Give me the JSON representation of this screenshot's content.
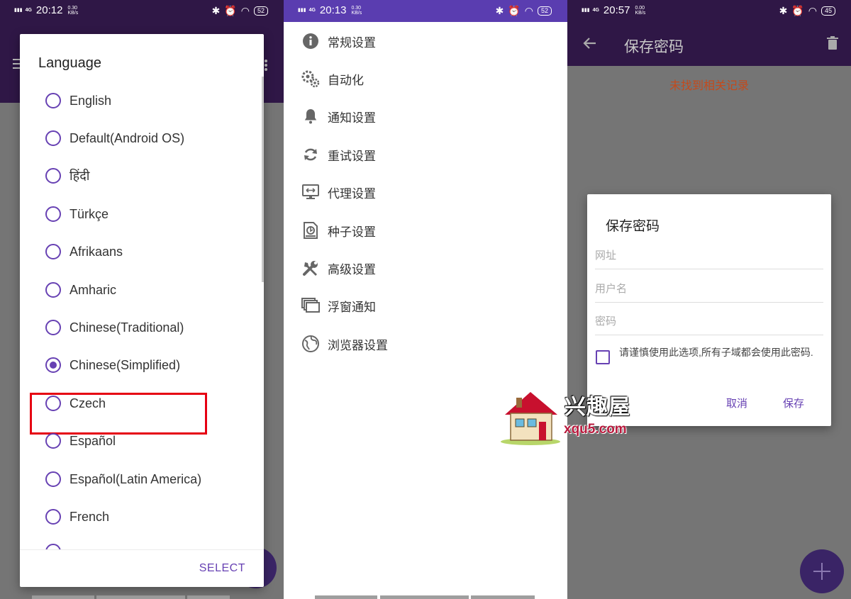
{
  "colors": {
    "accent": "#6741b3",
    "toolbar_dark": "#2f1746",
    "status_purple": "#5a3db0",
    "highlight_red": "#e60012",
    "warning_text": "#c44a1c"
  },
  "screens": [
    {
      "status": {
        "network": "4G",
        "time": "20:12",
        "speed": "0.30",
        "speed_unit": "KB/s",
        "battery": "52"
      },
      "dialog": {
        "title": "Language",
        "options": [
          {
            "label": "English",
            "checked": false
          },
          {
            "label": "Default(Android OS)",
            "checked": false
          },
          {
            "label": "हिंदी",
            "checked": false
          },
          {
            "label": "Türkçe",
            "checked": false
          },
          {
            "label": "Afrikaans",
            "checked": false
          },
          {
            "label": "Amharic",
            "checked": false
          },
          {
            "label": "Chinese(Traditional)",
            "checked": false
          },
          {
            "label": "Chinese(Simplified)",
            "checked": true
          },
          {
            "label": "Czech",
            "checked": false
          },
          {
            "label": "Español",
            "checked": false
          },
          {
            "label": "Español(Latin America)",
            "checked": false
          },
          {
            "label": "French",
            "checked": false
          }
        ],
        "select_label": "SELECT"
      }
    },
    {
      "status": {
        "network": "4G",
        "time": "20:13",
        "speed": "0.30",
        "speed_unit": "KB/s",
        "battery": "52"
      },
      "menu": [
        {
          "icon": "info-icon",
          "label": "常规设置"
        },
        {
          "icon": "automation-icon",
          "label": "自动化"
        },
        {
          "icon": "bell-icon",
          "label": "通知设置"
        },
        {
          "icon": "retry-icon",
          "label": "重试设置"
        },
        {
          "icon": "proxy-icon",
          "label": "代理设置"
        },
        {
          "icon": "torrent-icon",
          "label": "种子设置"
        },
        {
          "icon": "tools-icon",
          "label": "高级设置"
        },
        {
          "icon": "floating-window-icon",
          "label": "浮窗通知"
        },
        {
          "icon": "globe-icon",
          "label": "浏览器设置"
        }
      ]
    },
    {
      "status": {
        "network": "4G",
        "time": "20:57",
        "speed": "0.00",
        "speed_unit": "KB/s",
        "battery": "45"
      },
      "toolbar_title": "保存密码",
      "empty_message": "未找到相关记录",
      "dialog": {
        "title": "保存密码",
        "fields": {
          "url_placeholder": "网址",
          "username_placeholder": "用户名",
          "password_placeholder": "密码"
        },
        "checkbox_label": "请谨慎使用此选项,所有子域都会使用此密码.",
        "cancel_label": "取消",
        "save_label": "保存"
      }
    }
  ],
  "watermark": {
    "name": "兴趣屋",
    "url": "xqu5.com"
  }
}
